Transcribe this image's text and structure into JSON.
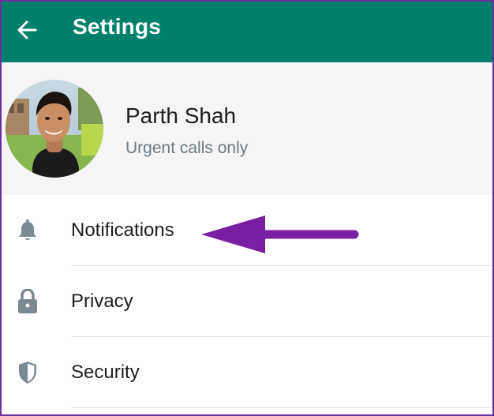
{
  "header": {
    "title": "Settings",
    "back_icon": "arrow-left-icon",
    "background_color": "#00806a"
  },
  "profile": {
    "name": "Parth Shah",
    "status": "Urgent calls only",
    "avatar": "profile-photo"
  },
  "menu": {
    "items": [
      {
        "label": "Notifications",
        "icon": "bell-icon"
      },
      {
        "label": "Privacy",
        "icon": "lock-icon"
      },
      {
        "label": "Security",
        "icon": "shield-icon"
      }
    ]
  },
  "annotation": {
    "arrow_color": "#7b1fa2",
    "arrow_points_to": "Notifications"
  }
}
